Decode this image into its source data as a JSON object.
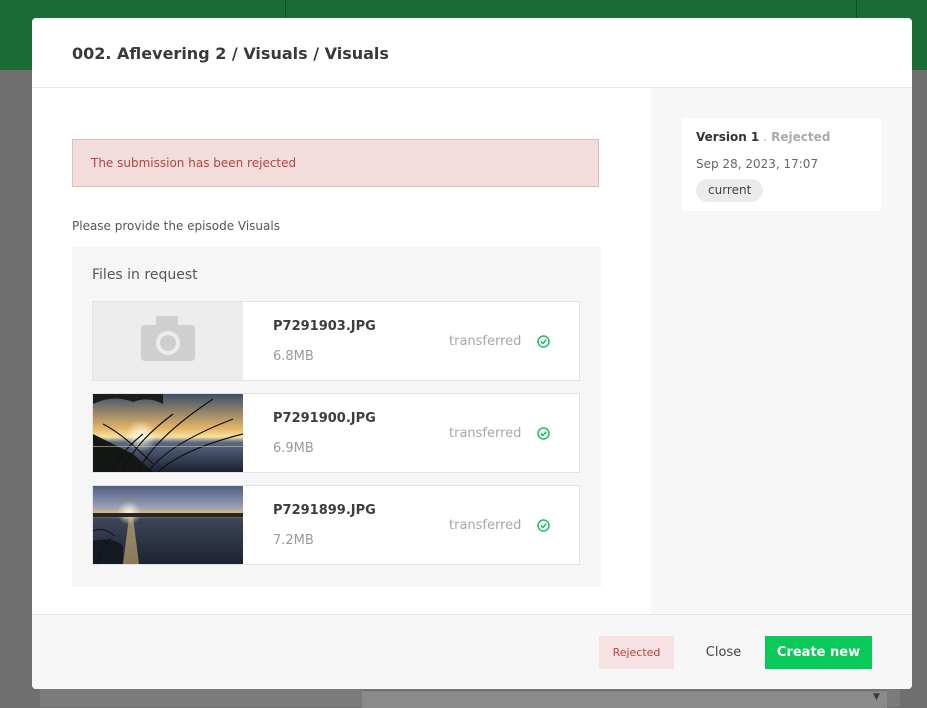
{
  "modal": {
    "title": "002. Aflevering 2 / Visuals / Visuals",
    "alert_text": "The submission has been rejected",
    "instructions": "Please provide the episode Visuals",
    "files_title": "Files in request",
    "files": [
      {
        "name": "P7291903.JPG",
        "size": "6.8MB",
        "status": "transferred",
        "thumbnail": "camera-placeholder"
      },
      {
        "name": "P7291900.JPG",
        "size": "6.9MB",
        "status": "transferred",
        "thumbnail": "sunset-reeds-photo"
      },
      {
        "name": "P7291899.JPG",
        "size": "7.2MB",
        "status": "transferred",
        "thumbnail": "sunset-lake-photo"
      }
    ]
  },
  "version": {
    "label": "Version 1",
    "separator": ".",
    "state": "Rejected",
    "date": "Sep 28, 2023, 17:07",
    "badge": "current"
  },
  "footer": {
    "rejected_label": "Rejected",
    "close_label": "Close",
    "create_label": "Create new"
  },
  "colors": {
    "brand_green": "#1b6b35",
    "accent_green": "#08c95a",
    "error_red": "#b2463f",
    "error_bg": "#f3dcdc"
  }
}
